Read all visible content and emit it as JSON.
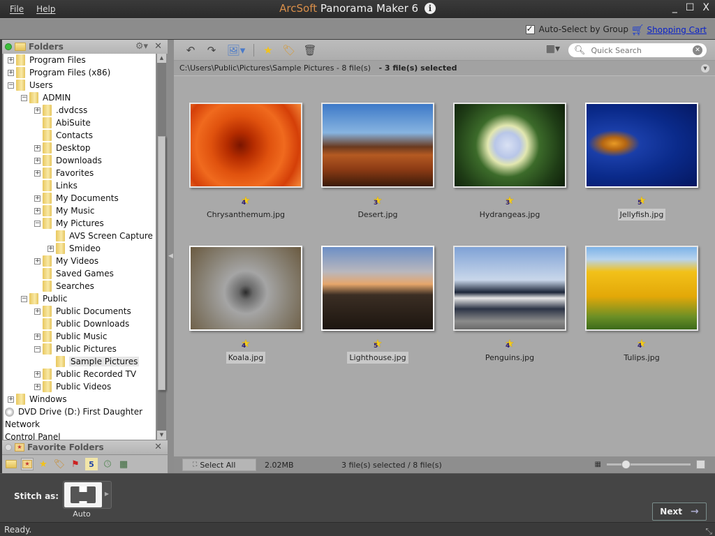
{
  "titlebar": {
    "menu": [
      "File",
      "Help"
    ],
    "brand": "ArcSoft",
    "product": " Panorama Maker 6",
    "info_icon": "i",
    "controls": {
      "minimize": "_",
      "maximize": "☐",
      "close": "X"
    }
  },
  "optbar": {
    "auto_select_label": "Auto-Select by Group",
    "auto_select_checked": true,
    "shopping_cart_label": "Shopping Cart"
  },
  "folders_panel": {
    "title": "Folders",
    "tree": [
      {
        "label": "Program Files",
        "depth": 0,
        "expander": "+"
      },
      {
        "label": "Program Files (x86)",
        "depth": 0,
        "expander": "+"
      },
      {
        "label": "Users",
        "depth": 0,
        "expander": "−"
      },
      {
        "label": "ADMIN",
        "depth": 1,
        "expander": "−"
      },
      {
        "label": ".dvdcss",
        "depth": 2,
        "expander": "+"
      },
      {
        "label": "AbiSuite",
        "depth": 2,
        "expander": ""
      },
      {
        "label": "Contacts",
        "depth": 2,
        "expander": ""
      },
      {
        "label": "Desktop",
        "depth": 2,
        "expander": "+"
      },
      {
        "label": "Downloads",
        "depth": 2,
        "expander": "+"
      },
      {
        "label": "Favorites",
        "depth": 2,
        "expander": "+"
      },
      {
        "label": "Links",
        "depth": 2,
        "expander": ""
      },
      {
        "label": "My Documents",
        "depth": 2,
        "expander": "+"
      },
      {
        "label": "My Music",
        "depth": 2,
        "expander": "+"
      },
      {
        "label": "My Pictures",
        "depth": 2,
        "expander": "−"
      },
      {
        "label": "AVS Screen Capture",
        "depth": 3,
        "expander": ""
      },
      {
        "label": "Smideo",
        "depth": 3,
        "expander": "+"
      },
      {
        "label": "My Videos",
        "depth": 2,
        "expander": "+"
      },
      {
        "label": "Saved Games",
        "depth": 2,
        "expander": ""
      },
      {
        "label": "Searches",
        "depth": 2,
        "expander": ""
      },
      {
        "label": "Public",
        "depth": 1,
        "expander": "−"
      },
      {
        "label": "Public Documents",
        "depth": 2,
        "expander": "+"
      },
      {
        "label": "Public Downloads",
        "depth": 2,
        "expander": ""
      },
      {
        "label": "Public Music",
        "depth": 2,
        "expander": "+"
      },
      {
        "label": "Public Pictures",
        "depth": 2,
        "expander": "−"
      },
      {
        "label": "Sample Pictures",
        "depth": 3,
        "expander": "",
        "selected": true
      },
      {
        "label": "Public Recorded TV",
        "depth": 2,
        "expander": "+"
      },
      {
        "label": "Public Videos",
        "depth": 2,
        "expander": "+"
      },
      {
        "label": "Windows",
        "depth": 0,
        "expander": "+"
      },
      {
        "label": "DVD Drive (D:) First Daughter",
        "depth": -1,
        "expander": "",
        "icon": "drive"
      },
      {
        "label": "Network",
        "depth": -1,
        "expander": "",
        "icon": "none"
      },
      {
        "label": "Control Panel",
        "depth": -1,
        "expander": "",
        "icon": "none"
      }
    ]
  },
  "favorites_panel": {
    "title": "Favorite Folders",
    "tools": [
      "folder-icon",
      "favorite-folder-icon",
      "star-icon",
      "tag-icon",
      "flag-icon",
      "calendar-icon",
      "recent-icon",
      "grid-icon"
    ]
  },
  "toolbar": {
    "search_placeholder": "Quick Search"
  },
  "pathbar": {
    "path": "C:\\Users\\Public\\Pictures\\Sample Pictures - 8 file(s)",
    "selection": "- 3 file(s) selected"
  },
  "files": [
    {
      "name": "Chrysanthemum.jpg",
      "rating": 4,
      "selected": false,
      "img": "img-chrys"
    },
    {
      "name": "Desert.jpg",
      "rating": 3,
      "selected": false,
      "img": "img-desert"
    },
    {
      "name": "Hydrangeas.jpg",
      "rating": 3,
      "selected": false,
      "img": "img-hydr"
    },
    {
      "name": "Jellyfish.jpg",
      "rating": 5,
      "selected": true,
      "img": "img-jelly"
    },
    {
      "name": "Koala.jpg",
      "rating": 4,
      "selected": true,
      "img": "img-koala"
    },
    {
      "name": "Lighthouse.jpg",
      "rating": 5,
      "selected": true,
      "img": "img-light"
    },
    {
      "name": "Penguins.jpg",
      "rating": 4,
      "selected": false,
      "img": "img-peng"
    },
    {
      "name": "Tulips.jpg",
      "rating": 4,
      "selected": false,
      "img": "img-tulip"
    }
  ],
  "statusstrip": {
    "select_all": "Select All",
    "size": "2.02MB",
    "selection": "3 file(s) selected / 8 file(s)",
    "thumbnail_zoom_fraction": 0.2
  },
  "stitch": {
    "label": "Stitch as:",
    "mode": "Auto"
  },
  "next_button": "Next",
  "status": "Ready."
}
